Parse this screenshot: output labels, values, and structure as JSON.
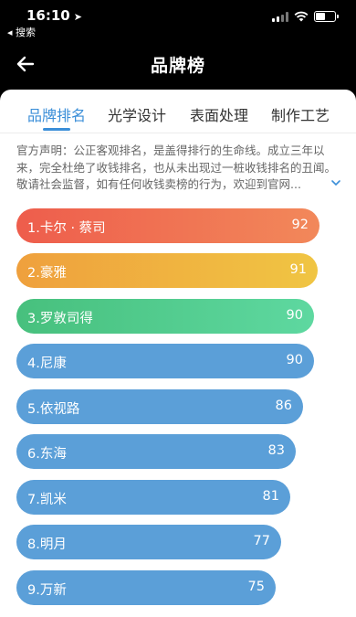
{
  "status_bar": {
    "time": "16:10",
    "back_app": "◂ 搜索",
    "battery_level": 0.55
  },
  "nav": {
    "title": "品牌榜"
  },
  "tabs": [
    {
      "label": "品牌排名",
      "active": true
    },
    {
      "label": "光学设计",
      "active": false
    },
    {
      "label": "表面处理",
      "active": false
    },
    {
      "label": "制作工艺",
      "active": false
    }
  ],
  "notice": {
    "text": "官方声明：公正客观排名，是盖得排行的生命线。成立三年以来，完全杜绝了收钱排名，也从未出现过一桩收钱排名的丑闻。敬请社会监督，如有任何收钱卖榜的行为，欢迎到官网..."
  },
  "colors": {
    "accent": "#3a8ed8",
    "rank1_start": "#ee5d4c",
    "rank1_end": "#f2885a",
    "rank2_start": "#efa03d",
    "rank2_end": "#f0c543",
    "rank3_start": "#47c07d",
    "rank3_end": "#5ed8a0",
    "rank_default": "#5b9fd8"
  },
  "ranking": [
    {
      "label": "1.卡尔 · 蔡司",
      "score": "92"
    },
    {
      "label": "2.豪雅",
      "score": "91"
    },
    {
      "label": "3.罗敦司得",
      "score": "90"
    },
    {
      "label": "4.尼康",
      "score": "90"
    },
    {
      "label": "5.依视路",
      "score": "86"
    },
    {
      "label": "6.东海",
      "score": "83"
    },
    {
      "label": "7.凯米",
      "score": "81"
    },
    {
      "label": "8.明月",
      "score": "77"
    },
    {
      "label": "9.万新",
      "score": "75"
    }
  ]
}
